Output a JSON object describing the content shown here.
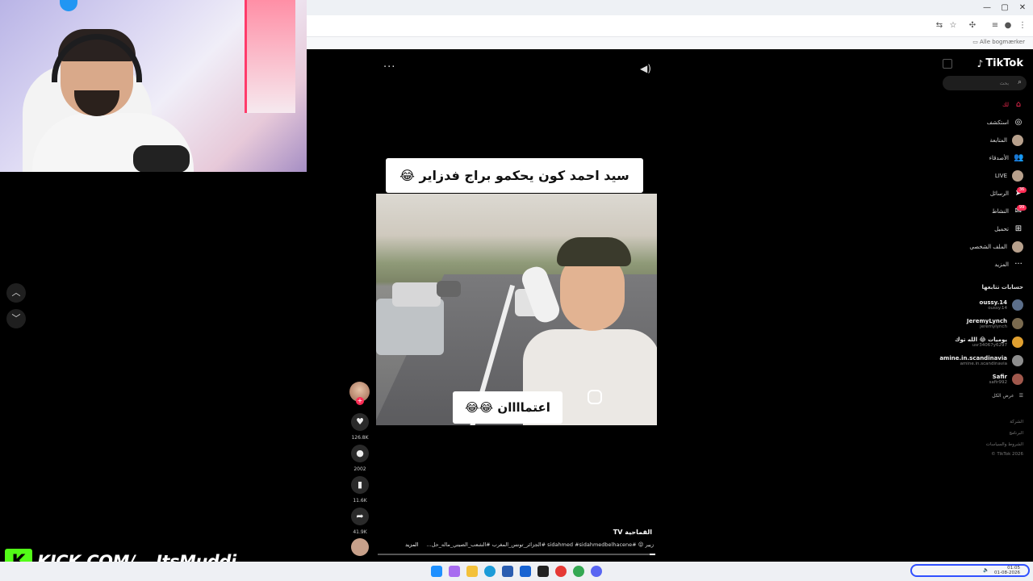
{
  "stream": {
    "kick_label": "KICK.COM/",
    "kick_logo": "K",
    "channel": "ItsMuddi"
  },
  "browser": {
    "bookmarks_label": "Alle bogmærker",
    "minimize": "—",
    "maximize": "▢",
    "close": "✕"
  },
  "video": {
    "caption_top": "سيد احمد كون يحكمو براج فدزاير 😂",
    "caption_bottom": "اعتماااان 😂😂",
    "more_icon": "···",
    "sound_icon": "◀)"
  },
  "actions": {
    "likes": "126.8K",
    "comments": "2002",
    "saves": "11.6K",
    "shares": "41.9K"
  },
  "post": {
    "author": "القماحية TV",
    "description": "زيير 😝 #sidahmed #sidahmedbelhacene #الجزائر_تونس_المغرب #الشعب_الصيني_ماله_حل...",
    "more_label": "المزيد",
    "progress": 0.02
  },
  "tiktok": {
    "logo": "TikTok",
    "search_placeholder": "بحث",
    "nav": [
      {
        "label": "لك",
        "icon": "home-icon",
        "glyph": "⌂"
      },
      {
        "label": "استكشف",
        "icon": "compass-icon",
        "glyph": "◎"
      },
      {
        "label": "المتابعة",
        "icon": "following-icon",
        "glyph": ""
      },
      {
        "label": "الأصدقاء",
        "icon": "friends-icon",
        "glyph": "👥"
      },
      {
        "label": "LIVE",
        "icon": "live-icon",
        "glyph": ""
      },
      {
        "label": "الرسائل",
        "icon": "messages-icon",
        "glyph": "➤",
        "badge": "36"
      },
      {
        "label": "النشاط",
        "icon": "activity-icon",
        "glyph": "✉",
        "badge": "99"
      },
      {
        "label": "تحميل",
        "icon": "upload-icon",
        "glyph": "⊞"
      },
      {
        "label": "الملف الشخصي",
        "icon": "profile-icon",
        "glyph": ""
      },
      {
        "label": "المزيد",
        "icon": "more-icon",
        "glyph": "···"
      }
    ],
    "following_header": "حسابات تتابعها",
    "accounts": [
      {
        "name": "oussy.14",
        "handle": "oussy.14"
      },
      {
        "name": "JeremyLynch",
        "handle": "jeremylynch"
      },
      {
        "name": "يوميات 😂 الله توك",
        "handle": "usr34067y6297"
      },
      {
        "name": "amine.in.scandinavia",
        "handle": "amine.in.scandinavia"
      },
      {
        "name": "Safir",
        "handle": "safir992"
      }
    ],
    "see_all": "عرض الكل",
    "footer": [
      "الشركة",
      "البرنامج",
      "الشروط والسياسات",
      "TikTok 2026 ©"
    ]
  },
  "taskbar": {
    "time": "01:05",
    "date": "01-08-2026"
  }
}
